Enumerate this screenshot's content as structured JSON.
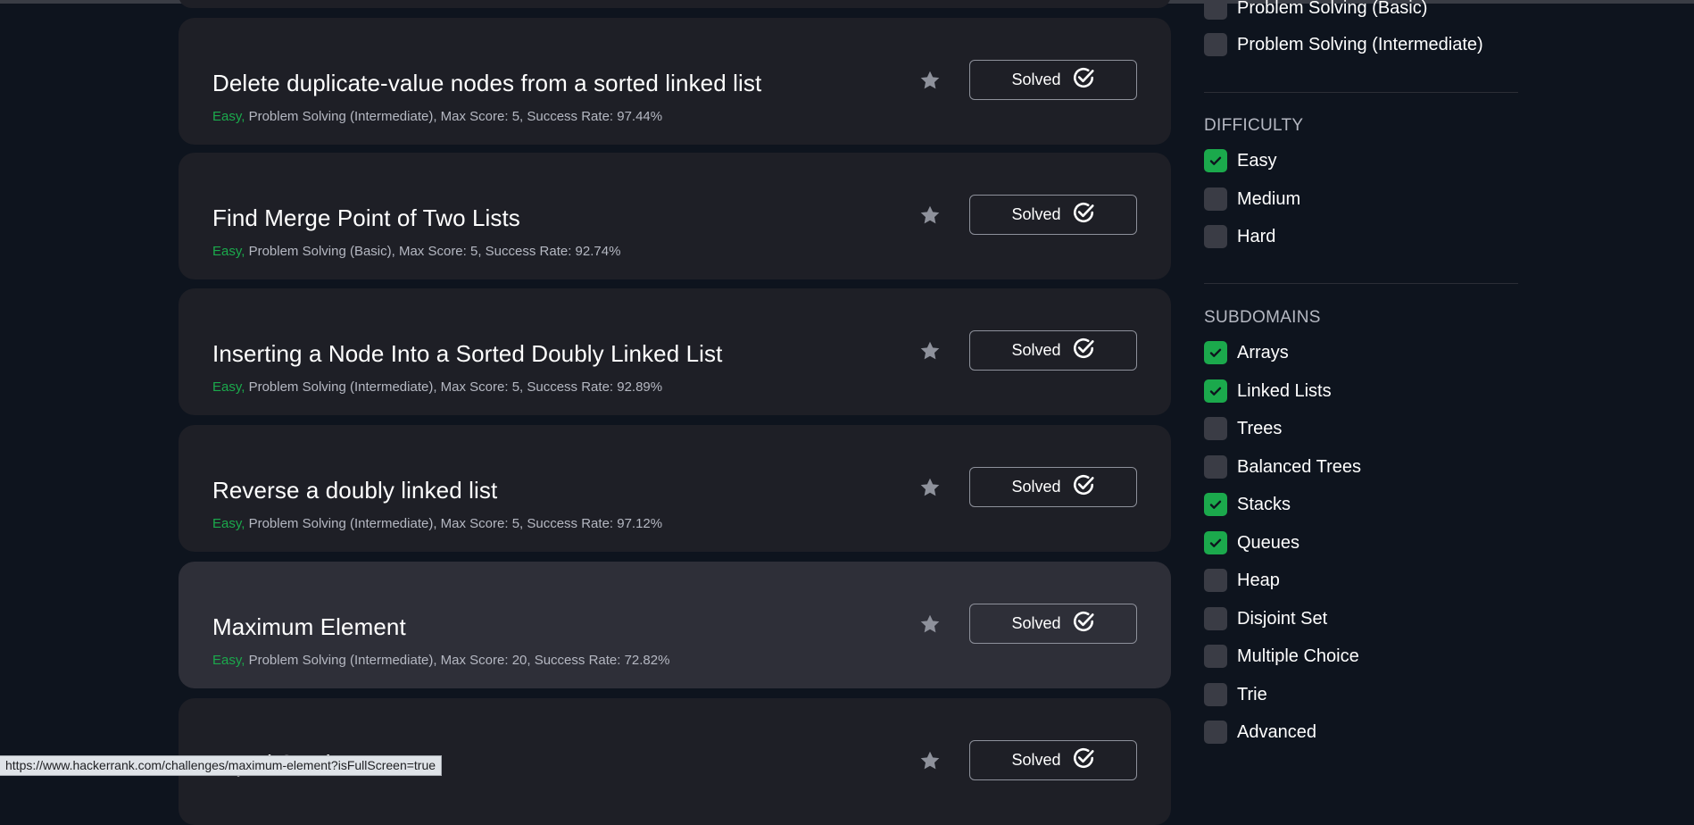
{
  "challenges": [
    {
      "title": "Delete duplicate-value nodes from a sorted linked list",
      "difficulty": "Easy,",
      "meta": " Problem Solving (Intermediate), Max Score: 5, Success Rate: 97.44%",
      "status_label": "Solved"
    },
    {
      "title": "Find Merge Point of Two Lists",
      "difficulty": "Easy,",
      "meta": " Problem Solving (Basic), Max Score: 5, Success Rate: 92.74%",
      "status_label": "Solved"
    },
    {
      "title": "Inserting a Node Into a Sorted Doubly Linked List",
      "difficulty": "Easy,",
      "meta": " Problem Solving (Intermediate), Max Score: 5, Success Rate: 92.89%",
      "status_label": "Solved"
    },
    {
      "title": "Reverse a doubly linked list",
      "difficulty": "Easy,",
      "meta": " Problem Solving (Intermediate), Max Score: 5, Success Rate: 97.12%",
      "status_label": "Solved"
    },
    {
      "title": "Maximum Element",
      "difficulty": "Easy,",
      "meta": " Problem Solving (Intermediate), Max Score: 20, Success Rate: 72.82%",
      "status_label": "Solved"
    },
    {
      "title": "Equal Stacks",
      "difficulty": "",
      "meta": "",
      "status_label": "Solved"
    }
  ],
  "filters": {
    "skills": [
      {
        "label": "Problem Solving (Basic)",
        "checked": false
      },
      {
        "label": "Problem Solving (Intermediate)",
        "checked": false
      }
    ],
    "difficulty": {
      "title": "DIFFICULTY",
      "items": [
        {
          "label": "Easy",
          "checked": true
        },
        {
          "label": "Medium",
          "checked": false
        },
        {
          "label": "Hard",
          "checked": false
        }
      ]
    },
    "subdomains": {
      "title": "SUBDOMAINS",
      "items": [
        {
          "label": "Arrays",
          "checked": true
        },
        {
          "label": "Linked Lists",
          "checked": true
        },
        {
          "label": "Trees",
          "checked": false
        },
        {
          "label": "Balanced Trees",
          "checked": false
        },
        {
          "label": "Stacks",
          "checked": true
        },
        {
          "label": "Queues",
          "checked": true
        },
        {
          "label": "Heap",
          "checked": false
        },
        {
          "label": "Disjoint Set",
          "checked": false
        },
        {
          "label": "Multiple Choice",
          "checked": false
        },
        {
          "label": "Trie",
          "checked": false
        },
        {
          "label": "Advanced",
          "checked": false
        }
      ]
    }
  },
  "status_bar": {
    "url": "https://www.hackerrank.com/challenges/maximum-element?isFullScreen=true"
  },
  "colors": {
    "background": "#0e141e",
    "card": "#1e1f26",
    "card_hover": "#2e2f38",
    "accent_green": "#1ba94c",
    "checkbox_off": "#3a3c45"
  },
  "icons": {
    "bookmark": "star-icon",
    "solved": "check-circle-icon",
    "checkbox_checked": "checkmark-icon"
  }
}
